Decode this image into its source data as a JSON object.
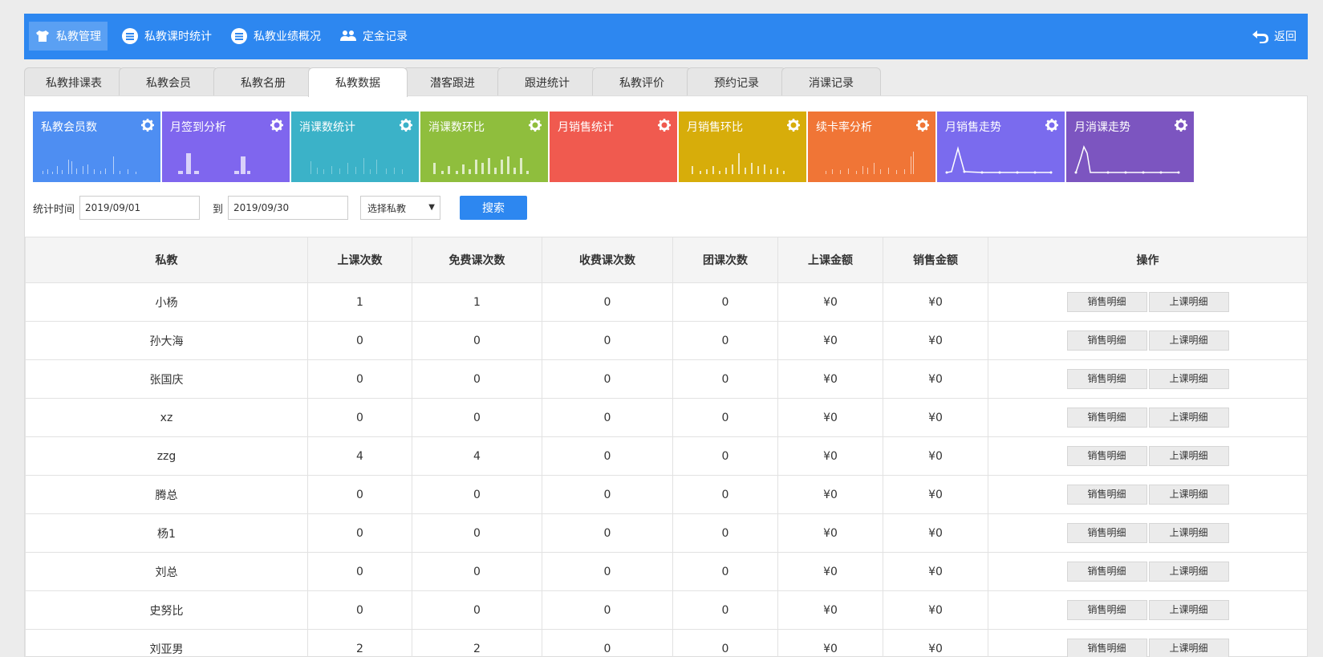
{
  "topnav": {
    "items": [
      {
        "label": "私教管理",
        "icon": "shirt-icon",
        "active": true
      },
      {
        "label": "私教课时统计",
        "icon": "list-icon",
        "active": false
      },
      {
        "label": "私教业绩概况",
        "icon": "list-icon",
        "active": false
      },
      {
        "label": "定金记录",
        "icon": "users-icon",
        "active": false
      }
    ],
    "back_label": "返回"
  },
  "tabs": [
    {
      "label": "私教排课表"
    },
    {
      "label": "私教会员"
    },
    {
      "label": "私教名册"
    },
    {
      "label": "私教数据",
      "active": true
    },
    {
      "label": "潜客跟进"
    },
    {
      "label": "跟进统计"
    },
    {
      "label": "私教评价"
    },
    {
      "label": "预约记录"
    },
    {
      "label": "消课记录"
    }
  ],
  "cards": [
    {
      "title": "私教会员数",
      "color": "#4e8ef2"
    },
    {
      "title": "月签到分析",
      "color": "#7f66ee"
    },
    {
      "title": "消课数统计",
      "color": "#3bb2c8"
    },
    {
      "title": "消课数环比",
      "color": "#8fbe3d"
    },
    {
      "title": "月销售统计",
      "color": "#f05a4f"
    },
    {
      "title": "月销售环比",
      "color": "#d7ad0a"
    },
    {
      "title": "续卡率分析",
      "color": "#f07536"
    },
    {
      "title": "月销售走势",
      "color": "#7a6bee"
    },
    {
      "title": "月消课走势",
      "color": "#7c55c0"
    }
  ],
  "filter": {
    "time_label": "统计时间",
    "start_date": "2019/09/01",
    "to_label": "到",
    "end_date": "2019/09/30",
    "coach_select": "选择私教",
    "search_label": "搜索"
  },
  "table": {
    "headers": [
      "私教",
      "上课次数",
      "免费课次数",
      "收费课次数",
      "团课次数",
      "上课金额",
      "销售金额",
      "操作"
    ],
    "rows": [
      [
        "小杨",
        "1",
        "1",
        "0",
        "0",
        "¥0",
        "¥0"
      ],
      [
        "孙大海",
        "0",
        "0",
        "0",
        "0",
        "¥0",
        "¥0"
      ],
      [
        "张国庆",
        "0",
        "0",
        "0",
        "0",
        "¥0",
        "¥0"
      ],
      [
        "xz",
        "0",
        "0",
        "0",
        "0",
        "¥0",
        "¥0"
      ],
      [
        "zzg",
        "4",
        "4",
        "0",
        "0",
        "¥0",
        "¥0"
      ],
      [
        "腾总",
        "0",
        "0",
        "0",
        "0",
        "¥0",
        "¥0"
      ],
      [
        "杨1",
        "0",
        "0",
        "0",
        "0",
        "¥0",
        "¥0"
      ],
      [
        "刘总",
        "0",
        "0",
        "0",
        "0",
        "¥0",
        "¥0"
      ],
      [
        "史努比",
        "0",
        "0",
        "0",
        "0",
        "¥0",
        "¥0"
      ],
      [
        "刘亚男",
        "2",
        "2",
        "0",
        "0",
        "¥0",
        "¥0"
      ]
    ],
    "sales_detail_label": "销售明细",
    "class_detail_label": "上课明细"
  }
}
